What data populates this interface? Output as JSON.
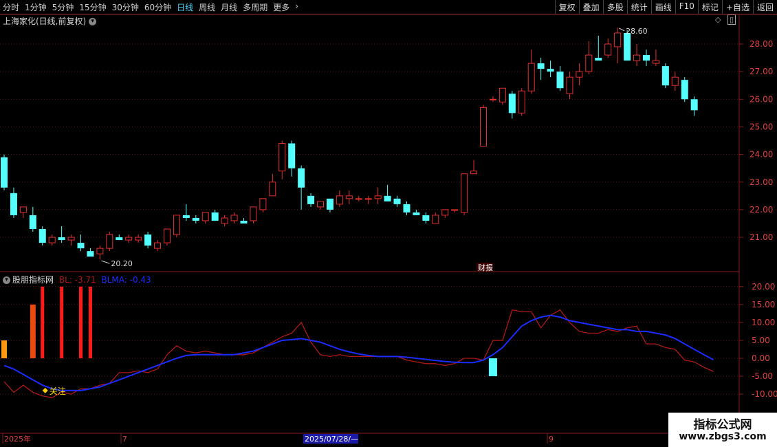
{
  "toolbar": {
    "periods": [
      "分时",
      "1分钟",
      "5分钟",
      "15分钟",
      "30分钟",
      "60分钟",
      "日线",
      "周线",
      "月线",
      "多周期",
      "更多"
    ],
    "active_period": "日线",
    "more_arrow": "›",
    "right_buttons": [
      "复权",
      "叠加",
      "多股",
      "统计",
      "画线",
      "F10",
      "标记",
      "+自选",
      "返回"
    ]
  },
  "main_panel": {
    "title": "上海家化(日线,前复权)",
    "high_label": "28.60",
    "low_label": "20.20",
    "event_label": "财报",
    "price_ticks": [
      "28.00",
      "27.00",
      "26.00",
      "25.00",
      "24.00",
      "23.00",
      "22.00",
      "21.00"
    ]
  },
  "indicator_panel": {
    "title": "股朋指标网",
    "bl_label": "BL: -3.71",
    "blma_label": "BLMA: -0.43",
    "marker_label": "关注",
    "ticks": [
      "20.00",
      "15.00",
      "10.00",
      "5.00",
      "0.00",
      "-5.00",
      "-10.00"
    ]
  },
  "time_axis": {
    "labels": [
      "2025年",
      "7",
      "9"
    ],
    "cursor_date": "2025/07/28/—"
  },
  "watermark": {
    "line1": "指标公式网",
    "line2": "www.zbgs3.com"
  },
  "colors": {
    "up": "#e83030",
    "down": "#54ffff",
    "bl_line": "#b01818",
    "blma_line": "#1a2cff",
    "grid": "#5a1a1a"
  },
  "chart_data": [
    {
      "type": "candlestick",
      "title": "上海家化(日线,前复权)",
      "ylim": [
        20.0,
        28.8
      ],
      "candles": [
        [
          23.9,
          24.0,
          22.7,
          22.8
        ],
        [
          22.6,
          22.8,
          21.7,
          21.8
        ],
        [
          21.9,
          22.0,
          21.7,
          22.1
        ],
        [
          21.8,
          22.1,
          21.2,
          21.3
        ],
        [
          21.3,
          21.4,
          20.7,
          20.8
        ],
        [
          20.8,
          21.1,
          20.7,
          21.0
        ],
        [
          21.0,
          21.4,
          20.8,
          20.9
        ],
        [
          20.9,
          21.1,
          20.7,
          21.0
        ],
        [
          20.8,
          21.1,
          20.5,
          20.6
        ],
        [
          20.5,
          20.6,
          20.3,
          20.3
        ],
        [
          20.4,
          20.7,
          20.2,
          20.6
        ],
        [
          20.6,
          21.2,
          20.5,
          21.1
        ],
        [
          21.0,
          21.1,
          20.9,
          20.9
        ],
        [
          20.9,
          21.1,
          20.8,
          21.0
        ],
        [
          20.9,
          21.1,
          20.8,
          21.0
        ],
        [
          21.1,
          21.2,
          20.6,
          20.7
        ],
        [
          20.6,
          20.9,
          20.5,
          20.8
        ],
        [
          20.8,
          21.3,
          20.7,
          21.3
        ],
        [
          21.1,
          21.8,
          21.0,
          21.8
        ],
        [
          21.8,
          22.2,
          21.6,
          21.7
        ],
        [
          21.7,
          21.8,
          21.5,
          21.6
        ],
        [
          21.6,
          21.9,
          21.5,
          21.9
        ],
        [
          21.9,
          22.0,
          21.7,
          21.6
        ],
        [
          21.5,
          21.8,
          21.4,
          21.7
        ],
        [
          21.6,
          21.9,
          21.5,
          21.8
        ],
        [
          21.6,
          21.7,
          21.5,
          21.5
        ],
        [
          21.6,
          22.1,
          21.5,
          22.1
        ],
        [
          22.0,
          22.4,
          21.9,
          22.4
        ],
        [
          22.5,
          23.3,
          22.5,
          23.0
        ],
        [
          23.4,
          24.5,
          23.1,
          24.4
        ],
        [
          24.4,
          24.5,
          23.2,
          23.5
        ],
        [
          23.5,
          23.6,
          22.0,
          22.8
        ],
        [
          22.5,
          22.6,
          22.1,
          22.2
        ],
        [
          22.1,
          22.3,
          22.0,
          22.3
        ],
        [
          22.4,
          22.4,
          21.9,
          22.0
        ],
        [
          22.2,
          22.7,
          22.1,
          22.5
        ],
        [
          22.4,
          22.7,
          22.2,
          22.5
        ],
        [
          22.4,
          22.5,
          22.3,
          22.4
        ],
        [
          22.4,
          22.5,
          22.2,
          22.4
        ],
        [
          22.4,
          22.8,
          22.2,
          22.5
        ],
        [
          22.5,
          22.9,
          22.3,
          22.3
        ],
        [
          22.4,
          22.5,
          22.1,
          22.2
        ],
        [
          22.2,
          22.3,
          21.8,
          21.9
        ],
        [
          21.9,
          22.0,
          21.8,
          21.8
        ],
        [
          21.8,
          21.9,
          21.5,
          21.6
        ],
        [
          21.5,
          21.9,
          21.5,
          21.8
        ],
        [
          21.8,
          22.0,
          21.7,
          22.0
        ],
        [
          22.0,
          22.0,
          21.9,
          22.0
        ],
        [
          21.9,
          23.3,
          21.8,
          23.3
        ],
        [
          23.3,
          23.8,
          23.3,
          23.4
        ],
        [
          24.3,
          25.8,
          24.3,
          25.7
        ],
        [
          26.0,
          26.1,
          25.9,
          26.0
        ],
        [
          25.9,
          26.4,
          25.8,
          26.4
        ],
        [
          26.2,
          26.3,
          25.3,
          25.5
        ],
        [
          25.5,
          26.4,
          25.4,
          26.3
        ],
        [
          26.3,
          27.8,
          26.2,
          27.3
        ],
        [
          27.3,
          27.5,
          26.7,
          27.1
        ],
        [
          27.1,
          27.4,
          26.8,
          27.0
        ],
        [
          27.0,
          27.2,
          26.3,
          26.4
        ],
        [
          26.2,
          27.0,
          26.0,
          26.8
        ],
        [
          26.8,
          27.3,
          26.5,
          27.0
        ],
        [
          27.0,
          28.1,
          26.9,
          27.6
        ],
        [
          27.5,
          28.3,
          27.4,
          27.4
        ],
        [
          27.6,
          28.2,
          27.5,
          28.0
        ],
        [
          27.9,
          28.6,
          27.3,
          28.4
        ],
        [
          28.4,
          28.5,
          27.4,
          27.4
        ],
        [
          27.4,
          28.0,
          27.2,
          27.6
        ],
        [
          27.6,
          27.8,
          27.2,
          27.4
        ],
        [
          27.3,
          27.8,
          27.2,
          27.4
        ],
        [
          27.2,
          27.3,
          26.4,
          26.5
        ],
        [
          26.5,
          27.0,
          26.3,
          26.8
        ],
        [
          26.7,
          26.8,
          25.9,
          26.0
        ],
        [
          26.0,
          26.1,
          25.4,
          25.6
        ]
      ]
    },
    {
      "type": "line",
      "title": "股朋指标网",
      "ylim": [
        -12,
        22
      ],
      "series": [
        {
          "name": "BL",
          "values": [
            -6.5,
            -9.5,
            -7.5,
            -9.5,
            -10.5,
            -11,
            -9.5,
            -10,
            -8.5,
            -8.5,
            -7.5,
            -7,
            -4,
            -4,
            -3.5,
            -4,
            -3,
            1,
            3.5,
            2,
            1.5,
            2,
            1.5,
            1,
            1,
            1,
            1.5,
            3,
            4.5,
            6,
            7,
            10,
            4.5,
            1,
            0.5,
            1,
            0.5,
            0.5,
            0.5,
            0.5,
            0.5,
            0.5,
            -0.5,
            -1,
            -1.5,
            -1.5,
            -2,
            -1.5,
            0,
            0,
            -0.5,
            5,
            5,
            13.5,
            13,
            13,
            8.5,
            12,
            13.5,
            10,
            7.5,
            7,
            7,
            8,
            7.5,
            8.5,
            9,
            4,
            4,
            3,
            2.5,
            -0.5,
            -1,
            -2.5,
            -3.7
          ]
        },
        {
          "name": "BLMA",
          "values": [
            -2,
            -3,
            -4.5,
            -6,
            -7.5,
            -8.5,
            -9,
            -9,
            -9,
            -8.5,
            -8,
            -7,
            -6,
            -5,
            -4,
            -3,
            -2,
            -1,
            0,
            0.8,
            1,
            1,
            1,
            1,
            1,
            1.5,
            2,
            3,
            4,
            5,
            5.2,
            5.5,
            5,
            4.5,
            3.5,
            2.5,
            1.8,
            1.2,
            0.8,
            0.5,
            0.5,
            0.5,
            0.3,
            0,
            -0.3,
            -0.6,
            -0.9,
            -1.1,
            -1.2,
            -1.2,
            -0.5,
            1,
            3,
            6,
            9,
            10.5,
            11.5,
            12,
            11.5,
            10.5,
            10,
            9.5,
            9,
            8.5,
            8,
            8,
            7.5,
            7.5,
            7,
            6.5,
            5.5,
            4,
            2.5,
            1,
            -0.4
          ]
        }
      ],
      "bars": [
        {
          "index": 0,
          "value": 5,
          "color": "#ff9810"
        },
        {
          "index": 3,
          "value": 15,
          "color": "#e84a10"
        },
        {
          "index": 4,
          "value": 20,
          "color": "#ff1a1a"
        },
        {
          "index": 6,
          "value": 20,
          "color": "#ff1a1a"
        },
        {
          "index": 8,
          "value": 20,
          "color": "#ff1a1a"
        },
        {
          "index": 9,
          "value": 20,
          "color": "#ff1a1a"
        },
        {
          "index": 51,
          "value": -5,
          "color": "#54ffff"
        }
      ]
    }
  ]
}
